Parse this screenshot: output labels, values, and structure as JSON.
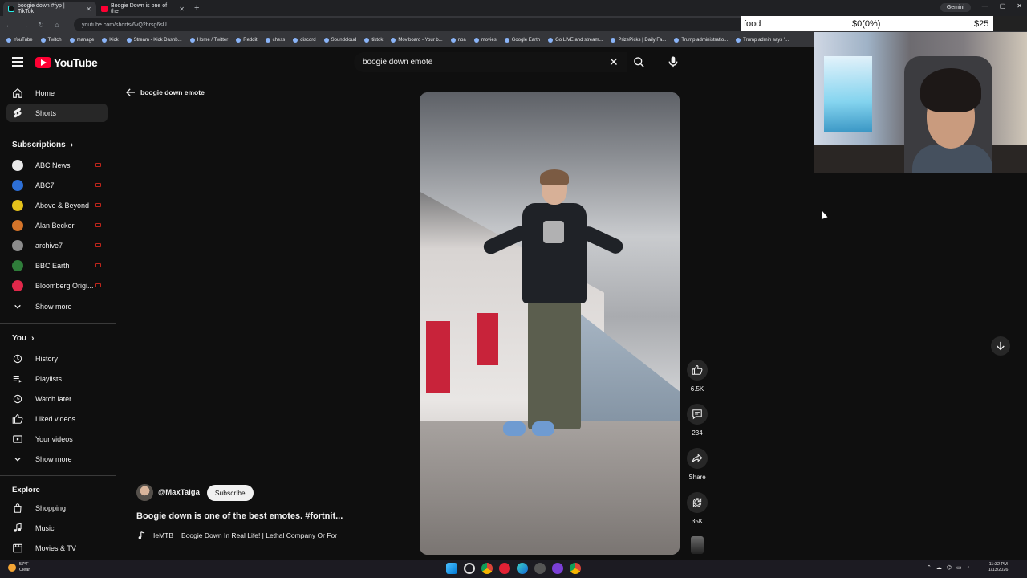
{
  "browser": {
    "tabs": [
      {
        "title": "boogie down #fyp | TikTok",
        "active": true
      },
      {
        "title": "Boogie Down is one of the",
        "active": false
      }
    ],
    "new_tab_glyph": "+",
    "gemini_label": "Gemini",
    "url": "youtube.com/shorts/6vQ2hrsg6sU",
    "bookmarks": [
      "YouTube",
      "Twitch",
      "manage",
      "Kick",
      "Stream - Kick Dashb...",
      "Home / Twitter",
      "Reddit",
      "chess",
      "discord",
      "Soundcloud",
      "tiktok",
      "Moviboard - Your b...",
      "nba",
      "movies",
      "Google Earth",
      "Go LIVE and stream...",
      "PrizePicks | Daily Fa...",
      "Trump administratio...",
      "Trump admin says '..."
    ]
  },
  "overlay": {
    "label": "food",
    "amount": "$0(0%)",
    "goal": "$25"
  },
  "youtube": {
    "logo_text": "YouTube",
    "search_value": "boogie down emote",
    "sidebar": {
      "main": [
        {
          "label": "Home",
          "icon": "home-icon"
        },
        {
          "label": "Shorts",
          "icon": "shorts-icon",
          "selected": true
        }
      ],
      "subscriptions_heading": "Subscriptions",
      "subscriptions": [
        {
          "label": "ABC News",
          "color": "#e8e8e8"
        },
        {
          "label": "ABC7",
          "color": "#2d6fd6"
        },
        {
          "label": "Above & Beyond",
          "color": "#e5c21b"
        },
        {
          "label": "Alan Becker",
          "color": "#d4742a"
        },
        {
          "label": "archive7",
          "color": "#8c8c8c"
        },
        {
          "label": "BBC Earth",
          "color": "#2f7d3a"
        },
        {
          "label": "Bloomberg Origi...",
          "color": "#e0284a"
        }
      ],
      "show_more_1": "Show more",
      "you_heading": "You",
      "you_items": [
        {
          "label": "History",
          "icon": "history-icon"
        },
        {
          "label": "Playlists",
          "icon": "playlists-icon"
        },
        {
          "label": "Watch later",
          "icon": "watch-later-icon"
        },
        {
          "label": "Liked videos",
          "icon": "liked-videos-icon"
        },
        {
          "label": "Your videos",
          "icon": "your-videos-icon"
        }
      ],
      "show_more_2": "Show more",
      "explore_heading": "Explore",
      "explore_items": [
        {
          "label": "Shopping",
          "icon": "shopping-icon"
        },
        {
          "label": "Music",
          "icon": "music-icon"
        },
        {
          "label": "Movies & TV",
          "icon": "movies-icon"
        }
      ]
    },
    "back_label": "boogie down emote",
    "short": {
      "channel": "@MaxTaiga",
      "subscribe_label": "Subscribe",
      "title": "Boogie down is one of the best emotes. #fortnit...",
      "sound_author": "IeMTB",
      "sound_title": "Boogie Down In Real Life! | Lethal Company Or For",
      "likes": "6.5K",
      "comments": "234",
      "share_label": "Share",
      "remix": "35K"
    }
  },
  "taskbar": {
    "weather_temp": "57°F",
    "weather_desc": "Clear",
    "time": "11:32 PM",
    "date": "1/13/2026"
  }
}
